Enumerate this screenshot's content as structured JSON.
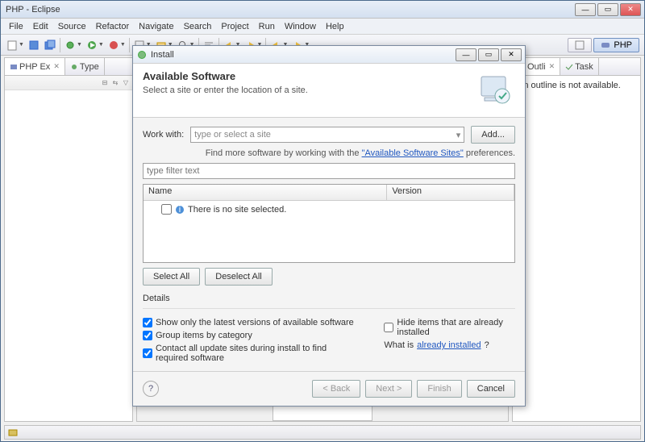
{
  "window": {
    "title": "PHP - Eclipse"
  },
  "menu": [
    "File",
    "Edit",
    "Source",
    "Refactor",
    "Navigate",
    "Search",
    "Project",
    "Run",
    "Window",
    "Help"
  ],
  "perspective": {
    "label": "PHP"
  },
  "left_views": {
    "tab1": "PHP Ex",
    "tab2": "Type"
  },
  "right_views": {
    "tab1": "Outli",
    "tab2": "Task",
    "outline_msg": "An outline is not available."
  },
  "dialog": {
    "title": "Install",
    "heading": "Available Software",
    "sub": "Select a site or enter the location of a site.",
    "work_with_label": "Work with:",
    "work_with_placeholder": "type or select a site",
    "add_btn": "Add...",
    "hint_prefix": "Find more software by working with the ",
    "hint_link": "\"Available Software Sites\"",
    "hint_suffix": " preferences.",
    "filter_placeholder": "type filter text",
    "col_name": "Name",
    "col_version": "Version",
    "no_site_row": "There is no site selected.",
    "select_all": "Select All",
    "deselect_all": "Deselect All",
    "details_label": "Details",
    "chk_latest": "Show only the latest versions of available software",
    "chk_group": "Group items by category",
    "chk_contact": "Contact all update sites during install to find required software",
    "chk_hide": "Hide items that are already installed",
    "what_is": "What is ",
    "already_link": "already installed",
    "back": "< Back",
    "next": "Next >",
    "finish": "Finish",
    "cancel": "Cancel"
  }
}
